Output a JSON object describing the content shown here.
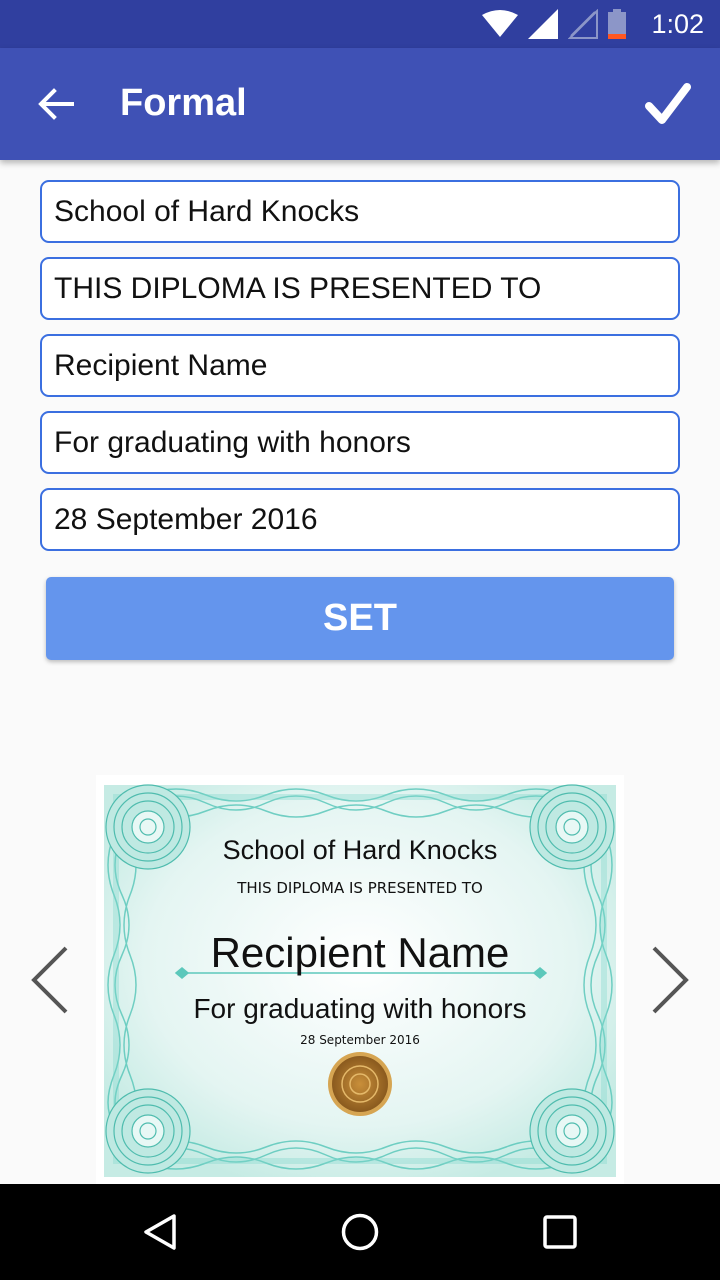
{
  "status_bar": {
    "time": "1:02"
  },
  "app_bar": {
    "title": "Formal"
  },
  "form": {
    "fields": [
      "School of Hard Knocks",
      "THIS DIPLOMA IS PRESENTED TO",
      "Recipient Name",
      "For graduating with honors",
      "28 September 2016"
    ],
    "set_label": "SET"
  },
  "certificate": {
    "school": "School of Hard Knocks",
    "presented": "THIS DIPLOMA IS PRESENTED TO",
    "recipient": "Recipient Name",
    "reason": "For graduating with honors",
    "date": "28 September 2016"
  },
  "icons": {
    "back": "arrow-left-icon",
    "confirm": "check-icon",
    "prev": "chevron-left-icon",
    "next": "chevron-right-icon"
  },
  "colors": {
    "status_bar": "#303f9f",
    "app_bar": "#3f51b5",
    "field_border": "#3b6fe0",
    "set_button": "#6495ed",
    "certificate_frame": "#5cc8bb",
    "seal": "#a0702a"
  }
}
